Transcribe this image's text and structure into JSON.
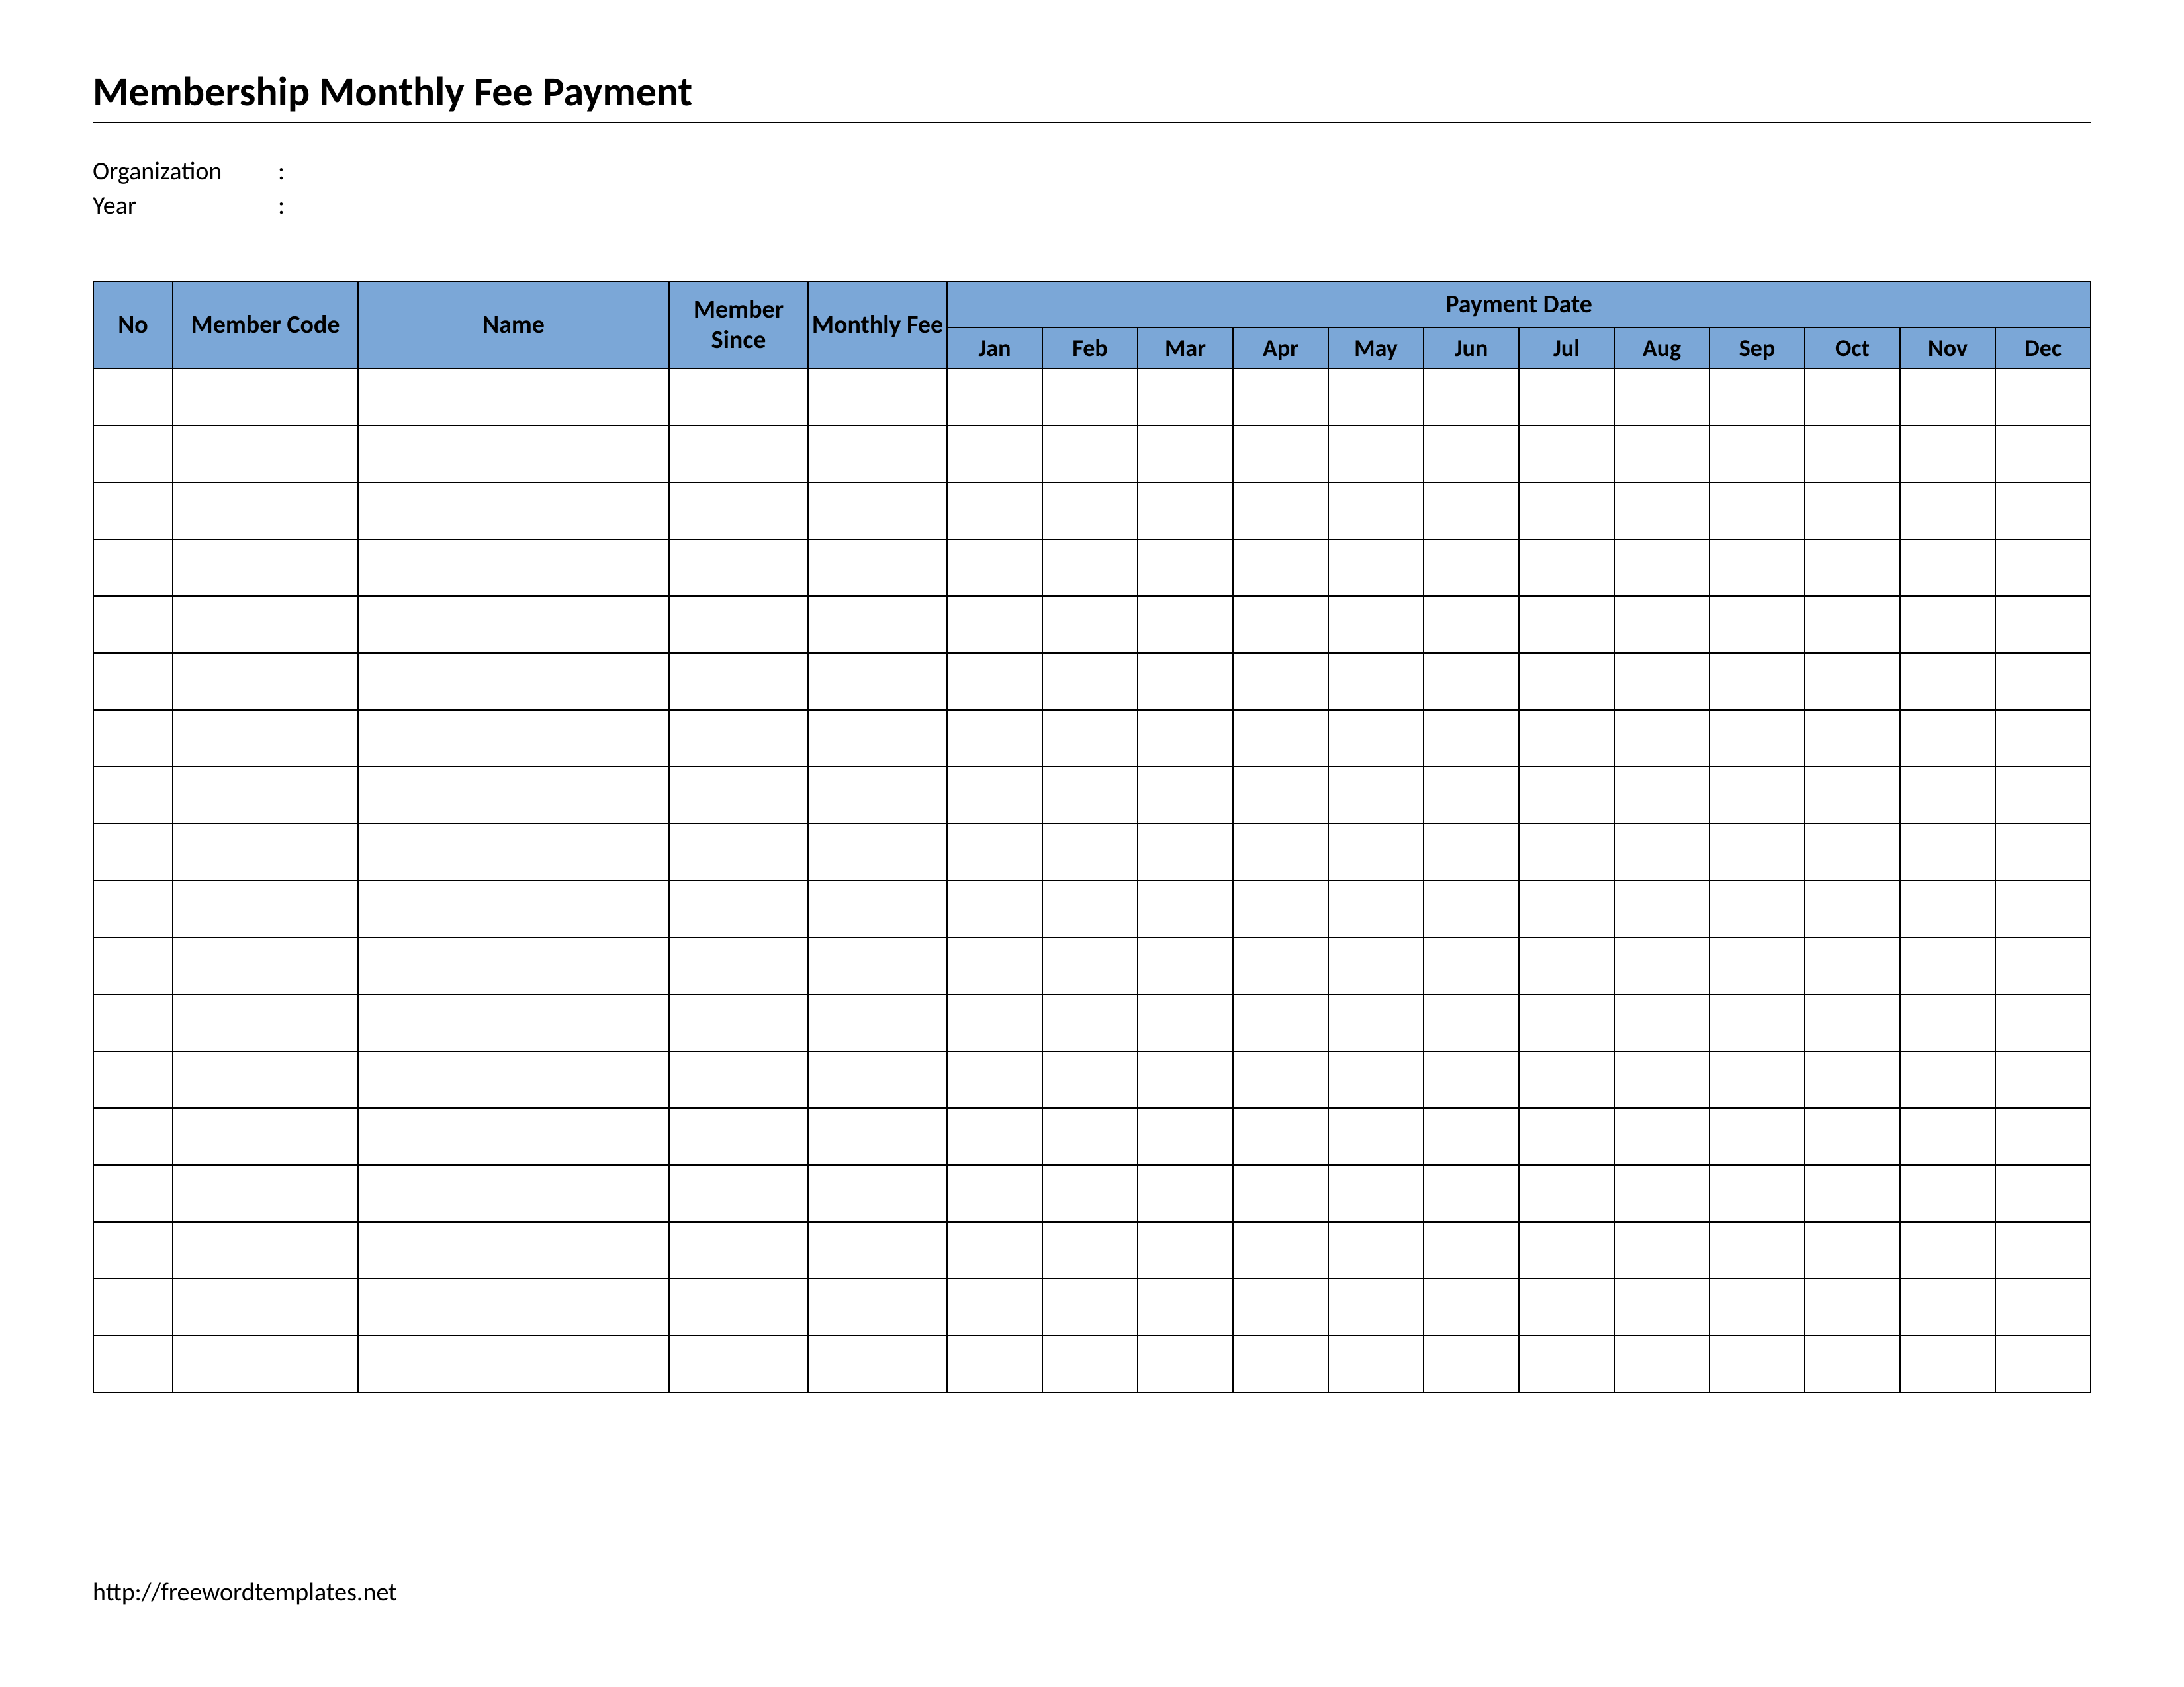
{
  "title": "Membership Monthly Fee Payment",
  "meta": {
    "organization_label": "Organization",
    "organization_value": "",
    "year_label": "Year",
    "year_value": "",
    "colon": ":"
  },
  "headers": {
    "no": "No",
    "member_code": "Member Code",
    "name": "Name",
    "member_since": "Member Since",
    "monthly_fee": "Monthly Fee",
    "payment_date": "Payment Date"
  },
  "months": [
    "Jan",
    "Feb",
    "Mar",
    "Apr",
    "May",
    "Jun",
    "Jul",
    "Aug",
    "Sep",
    "Oct",
    "Nov",
    "Dec"
  ],
  "row_count": 18,
  "footer": "http://freewordtemplates.net"
}
